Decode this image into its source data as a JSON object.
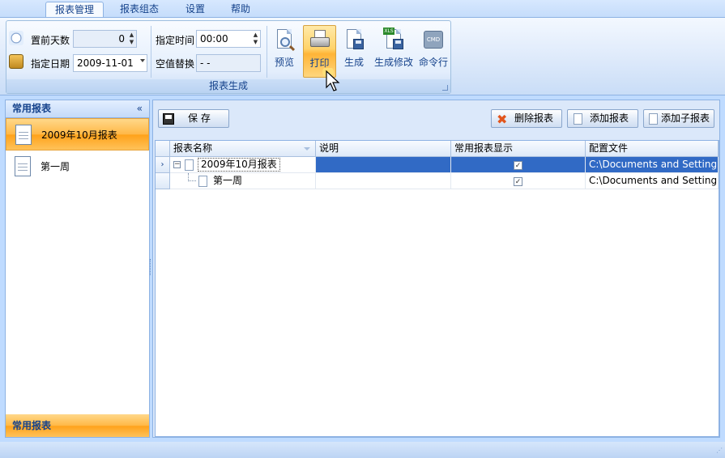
{
  "tabs": [
    "报表管理",
    "报表组态",
    "设置",
    "帮助"
  ],
  "ribbon": {
    "group_label": "报表生成",
    "fields": {
      "days_label": "置前天数",
      "days_value": "0",
      "date_label": "指定日期",
      "date_value": "2009-11-01",
      "time_label": "指定时间",
      "time_value": "00:00",
      "null_label": "空值替换",
      "null_value": "- -"
    },
    "buttons": {
      "preview": "预览",
      "print": "打印",
      "generate": "生成",
      "generate_edit": "生成修改",
      "cmd": "命令行",
      "cmd_icon_text": "CMD",
      "xls_icon_text": "XLS"
    }
  },
  "left_panel": {
    "title": "常用报表",
    "collapse": "«",
    "items": [
      "2009年10月报表",
      "第一周"
    ],
    "footer": "常用报表"
  },
  "toolbar": {
    "save": "保  存",
    "delete": "删除报表",
    "add": "添加报表",
    "add_child": "添加子报表"
  },
  "grid": {
    "columns": [
      "报表名称",
      "说明",
      "常用报表显示",
      "配置文件"
    ],
    "rows": [
      {
        "name": "2009年10月报表",
        "desc": "",
        "checked": "✓",
        "config": "C:\\Documents and Setting..."
      },
      {
        "name": "第一周",
        "desc": "",
        "checked": "✓",
        "config": "C:\\Documents and Setting..."
      }
    ],
    "expander": "−",
    "row_indicator": "›"
  },
  "colors": {
    "accent": "#ffb846",
    "selection": "#316ac5",
    "ribbon_text": "#15428b"
  }
}
